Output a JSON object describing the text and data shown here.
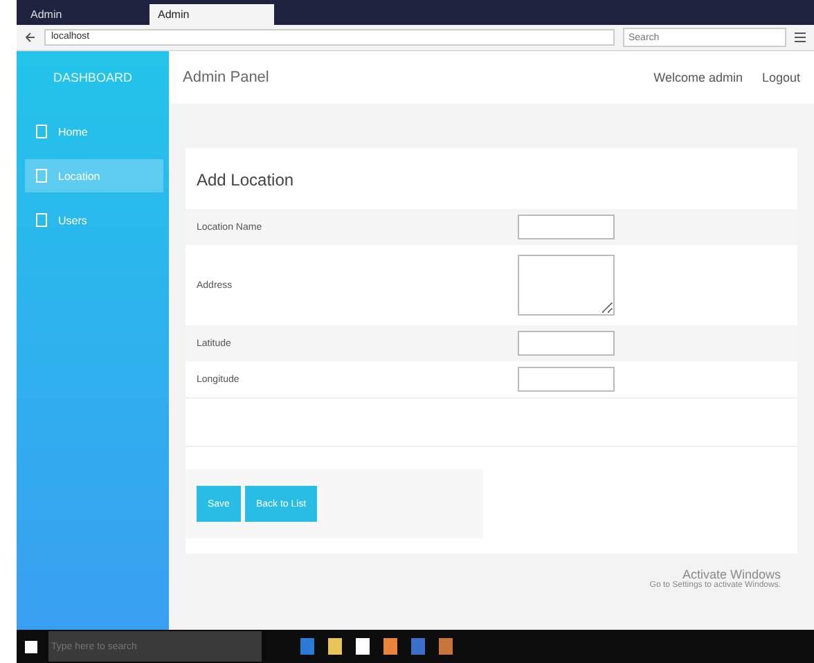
{
  "browser": {
    "tabs": [
      {
        "label": "Admin",
        "selected": false
      },
      {
        "label": "Admin",
        "selected": true
      }
    ],
    "url": "localhost",
    "search": {
      "placeholder": "Search"
    }
  },
  "sidebar": {
    "title": "DASHBOARD",
    "items": [
      {
        "label": "Home",
        "selected": false
      },
      {
        "label": "Location",
        "selected": true
      },
      {
        "label": "Users",
        "selected": false
      }
    ]
  },
  "header": {
    "title": "Admin Panel",
    "welcome": "Welcome admin",
    "logout": "Logout"
  },
  "form": {
    "title": "Add Location",
    "fields": [
      {
        "label": "Location Name",
        "kind": "input"
      },
      {
        "label": "Address",
        "kind": "textarea"
      },
      {
        "label": "Latitude",
        "kind": "input"
      },
      {
        "label": "Longitude",
        "kind": "input"
      }
    ],
    "buttons": [
      "Save",
      "Back to List"
    ]
  },
  "watermark": {
    "title": "Activate Windows",
    "subtitle": "Go to Settings to activate Windows."
  },
  "taskbar": {
    "search": {
      "placeholder": "Type here to search"
    }
  }
}
